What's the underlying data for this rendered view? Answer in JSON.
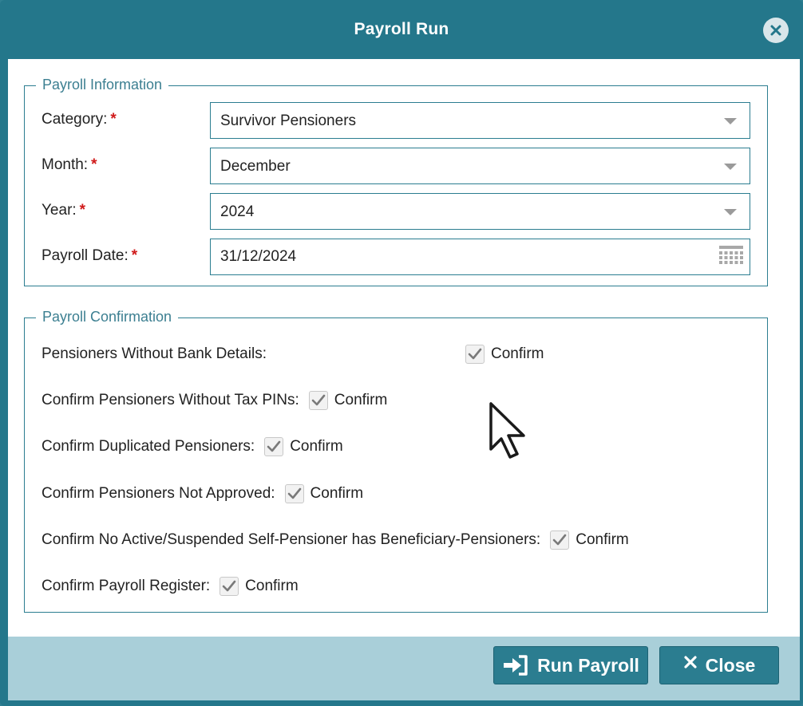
{
  "dialog": {
    "title": "Payroll Run"
  },
  "payroll_information": {
    "legend": "Payroll Information",
    "required_marker": "*",
    "category": {
      "label": "Category:",
      "value": "Survivor Pensioners"
    },
    "month": {
      "label": "Month:",
      "value": "December"
    },
    "year": {
      "label": "Year:",
      "value": "2024"
    },
    "payroll_date": {
      "label": "Payroll Date:",
      "value": "31/12/2024"
    }
  },
  "payroll_confirmation": {
    "legend": "Payroll Confirmation",
    "checkbox_label": "Confirm",
    "items": [
      {
        "label": "Pensioners Without Bank Details:",
        "checked": true
      },
      {
        "label": "Confirm Pensioners Without Tax PINs:",
        "checked": true
      },
      {
        "label": "Confirm Duplicated Pensioners:",
        "checked": true
      },
      {
        "label": "Confirm Pensioners Not Approved:",
        "checked": true
      },
      {
        "label": "Confirm No Active/Suspended Self-Pensioner has Beneficiary-Pensioners:",
        "checked": true
      },
      {
        "label": "Confirm Payroll Register:",
        "checked": true
      }
    ]
  },
  "footer": {
    "run_label": "Run Payroll",
    "close_label": "Close"
  },
  "icons": {
    "dialog_close": "close-circle-icon",
    "dropdown": "chevron-down-icon",
    "date": "calendar-icon",
    "check": "check-icon",
    "run": "sign-in-icon",
    "close": "close-icon",
    "pointer": "mouse-pointer-icon"
  },
  "colors": {
    "header": "#24778b",
    "accent": "#2b7d90",
    "footer": "#a9cfd9",
    "required": "#d01a1a",
    "legend": "#3c7f91"
  }
}
